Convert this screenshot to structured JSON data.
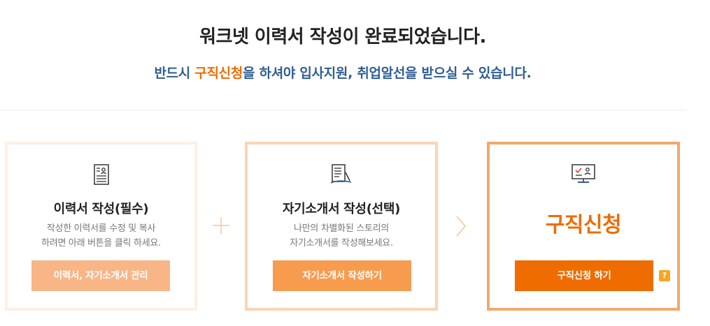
{
  "header": {
    "title": "워크넷 이력서 작성이 완료되었습니다.",
    "subtitle_pre": "반드시 ",
    "subtitle_highlight": "구직신청",
    "subtitle_post": "을 하셔야 입사지원, 취업알선을 받으실 수 있습니다."
  },
  "cards": [
    {
      "icon": "resume-document-icon",
      "title": "이력서 작성(필수)",
      "desc_line1": "작성한 이력서를 수정 및 복사",
      "desc_line2": "하려면 아래 버튼을 클릭 하세요.",
      "button_label": "이력서, 자기소개서 관리"
    },
    {
      "icon": "cover-letter-icon",
      "title": "자기소개서 작성(선택)",
      "desc_line1": "나만의 차별화된 스토리의",
      "desc_line2": "자기소개서를 작성해보세요.",
      "button_label": "자기소개서 작성하기"
    },
    {
      "icon": "monitor-apply-icon",
      "title": "구직신청",
      "button_label": "구직신청 하기",
      "help_label": "?"
    }
  ],
  "separators": {
    "first": "plus-icon",
    "second": "chevron-right-icon"
  },
  "colors": {
    "accent_orange": "#ef6c00",
    "subtitle_blue": "#2f5d93",
    "button_light": "#f8b586",
    "button_mid": "#f79c4f",
    "help_yellow": "#f5a623"
  }
}
